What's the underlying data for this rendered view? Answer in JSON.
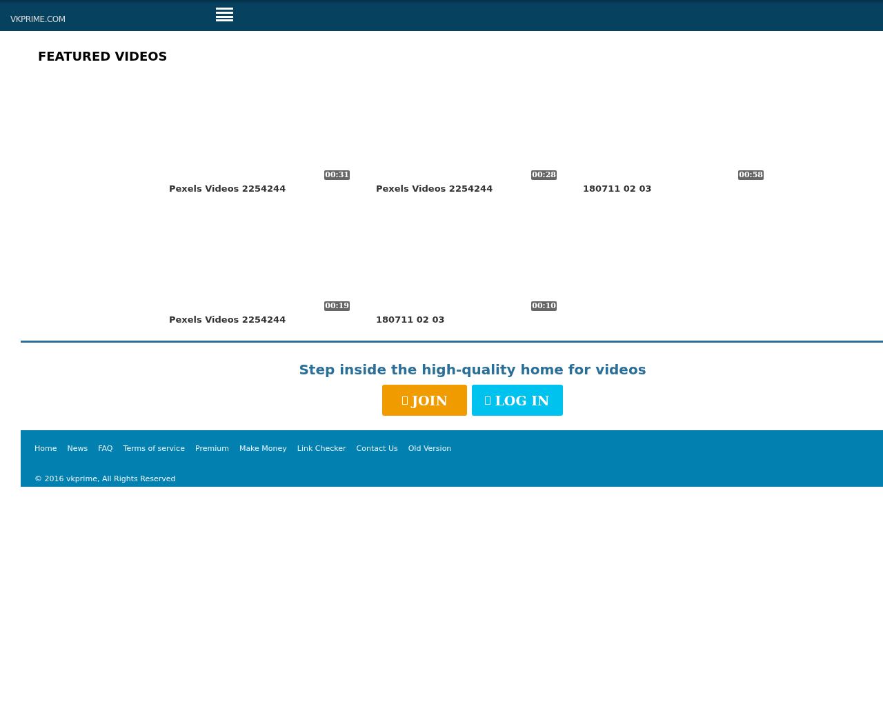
{
  "header": {
    "logo": "VKPRIME.COM"
  },
  "featured": {
    "title": "FEATURED VIDEOS",
    "videos": [
      {
        "title": "Pexels Videos 2254244",
        "duration": "00:31"
      },
      {
        "title": "Pexels Videos 2254244",
        "duration": "00:28"
      },
      {
        "title": "180711 02 03",
        "duration": "00:58"
      },
      {
        "title": "Pexels Videos 2254244",
        "duration": "00:19"
      },
      {
        "title": "180711 02 03",
        "duration": "00:10"
      }
    ]
  },
  "cta": {
    "text": "Step inside the high-quality home for videos",
    "buttons": [
      {
        "label": "JOIN",
        "kind": "join"
      },
      {
        "label": "LOG IN",
        "kind": "login"
      }
    ]
  },
  "footer": {
    "links": [
      "Home",
      "News",
      "FAQ",
      "Terms of service",
      "Premium",
      "Make Money",
      "Link Checker",
      "Contact Us",
      "Old Version"
    ],
    "copyright": "© 2016 vkprime, All Rights Reserved"
  }
}
